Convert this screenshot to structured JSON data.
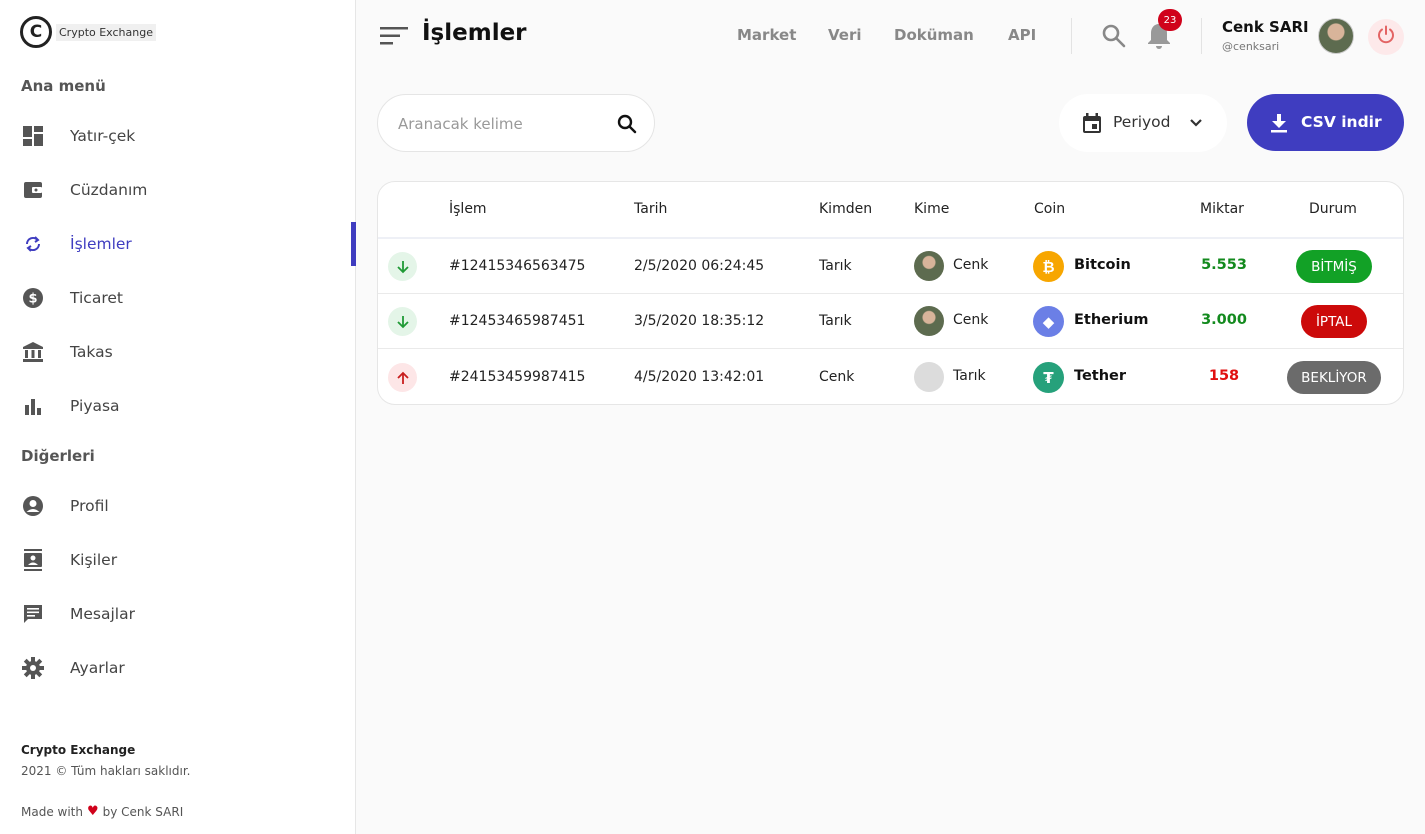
{
  "brand": {
    "name": "Crypto Exchange",
    "mark": "C"
  },
  "sidebar": {
    "main_title": "Ana menü",
    "main_items": [
      {
        "label": "Yatır-çek",
        "icon": "dashboard-icon"
      },
      {
        "label": "Cüzdanım",
        "icon": "wallet-icon"
      },
      {
        "label": "İşlemler",
        "icon": "sync-icon",
        "active": true
      },
      {
        "label": "Ticaret",
        "icon": "dollar-icon"
      },
      {
        "label": "Takas",
        "icon": "bank-icon"
      },
      {
        "label": "Piyasa",
        "icon": "bar-chart-icon"
      }
    ],
    "other_title": "Diğerleri",
    "other_items": [
      {
        "label": "Profil",
        "icon": "profile-icon"
      },
      {
        "label": "Kişiler",
        "icon": "contacts-icon"
      },
      {
        "label": "Mesajlar",
        "icon": "message-icon"
      },
      {
        "label": "Ayarlar",
        "icon": "settings-icon"
      }
    ],
    "footer": {
      "brand": "Crypto Exchange",
      "copyright": "2021 © Tüm hakları saklıdır.",
      "made_prefix": "Made with",
      "heart": "♥",
      "made_suffix": "by Cenk SARI"
    }
  },
  "header": {
    "title": "İşlemler",
    "links": [
      "Market",
      "Veri",
      "Doküman",
      "API"
    ],
    "notification_count": "23",
    "user": {
      "name": "Cenk SARI",
      "handle": "@cenksari"
    }
  },
  "toolbar": {
    "search_placeholder": "Aranacak kelime",
    "period_label": "Periyod",
    "csv_label": "CSV indir"
  },
  "table": {
    "columns": [
      "İşlem",
      "Tarih",
      "Kimden",
      "Kime",
      "Coin",
      "Miktar",
      "Durum"
    ],
    "rows": [
      {
        "direction": "in",
        "id": "#12415346563475",
        "date": "2/5/2020 06:24:45",
        "from": "Tarık",
        "to": "Cenk",
        "to_avatar": "photo",
        "coin": "Bitcoin",
        "coin_symbol": "₿",
        "coin_color": "#f7a600",
        "amount": "5.553",
        "amount_color": "#138a1e",
        "status": "BİTMİŞ",
        "status_color": "#12a126"
      },
      {
        "direction": "in",
        "id": "#12453465987451",
        "date": "3/5/2020 18:35:12",
        "from": "Tarık",
        "to": "Cenk",
        "to_avatar": "photo",
        "coin": "Etherium",
        "coin_symbol": "◆",
        "coin_color": "#6b7fe6",
        "amount": "3.000",
        "amount_color": "#138a1e",
        "status": "İPTAL",
        "status_color": "#cc0a0a"
      },
      {
        "direction": "out",
        "id": "#24153459987415",
        "date": "4/5/2020 13:42:01",
        "from": "Cenk",
        "to": "Tarık",
        "to_avatar": "blank",
        "coin": "Tether",
        "coin_symbol": "₮",
        "coin_color": "#26a17b",
        "amount": "158",
        "amount_color": "#e01010",
        "status": "BEKLİYOR",
        "status_color": "#6b6b6b"
      }
    ]
  },
  "colors": {
    "accent": "#3f3dc0",
    "positive": "#138a1e",
    "negative": "#e01010"
  }
}
